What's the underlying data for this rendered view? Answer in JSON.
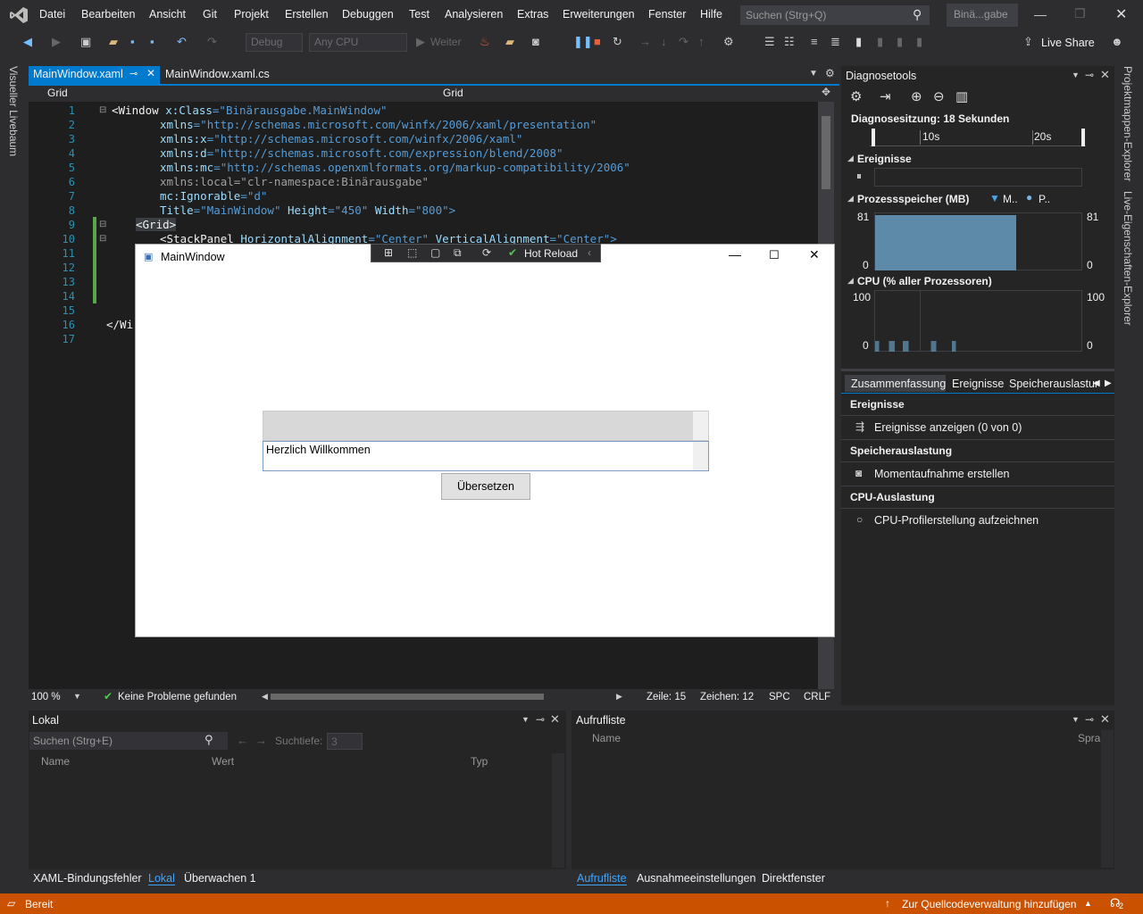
{
  "menu": [
    "Datei",
    "Bearbeiten",
    "Ansicht",
    "Git",
    "Projekt",
    "Erstellen",
    "Debuggen",
    "Test",
    "Analysieren",
    "Extras",
    "Erweiterungen",
    "Fenster",
    "Hilfe"
  ],
  "search_placeholder": "Suchen (Strg+Q)",
  "solution_name": "Binä...gabe",
  "toolbar": {
    "config": "Debug",
    "platform": "Any CPU",
    "continue": "Weiter",
    "live_share": "Live Share"
  },
  "tabs": {
    "active": "MainWindow.xaml",
    "other": "MainWindow.xaml.cs",
    "nav_left": "Grid",
    "nav_right": "Grid"
  },
  "side_left": "Visueller Livebaum",
  "side_right_1": "Projektmappen-Explorer",
  "side_right_2": "Live-Eigenschaften-Explorer",
  "line_numbers": [
    "1",
    "2",
    "3",
    "4",
    "5",
    "6",
    "7",
    "8",
    "9",
    "10",
    "11",
    "12",
    "13",
    "14",
    "15",
    "16",
    "17"
  ],
  "code": {
    "l1a": "<Window ",
    "l1b": "x:Class",
    "l1c": "=\"Binärausgabe.MainWindow\"",
    "l2a": "xmlns",
    "l2b": "=\"http://schemas.microsoft.com/winfx/2006/xaml/presentation\"",
    "l3a": "xmlns:x",
    "l3b": "=\"http://schemas.microsoft.com/winfx/2006/xaml\"",
    "l4a": "xmlns:d",
    "l4b": "=\"http://schemas.microsoft.com/expression/blend/2008\"",
    "l5a": "xmlns:mc",
    "l5b": "=\"http://schemas.openxmlformats.org/markup-compatibility/2006\"",
    "l6": "xmlns:local=\"clr-namespace:Binärausgabe\"",
    "l7a": "mc:Ignorable",
    "l7b": "=\"d\"",
    "l8a": "Title",
    "l8b": "=\"MainWindow\" ",
    "l8c": "Height",
    "l8d": "=\"450\" ",
    "l8e": "Width",
    "l8f": "=\"800\">",
    "l9": "<Grid>",
    "l10a": "<StackPanel ",
    "l10b": "HorizontalAlignment",
    "l10c": "=\"Center\" ",
    "l10d": "VerticalAlignment",
    "l10e": "=\"Center\">",
    "l16": "</Wi"
  },
  "editor_status": {
    "zoom": "100 %",
    "problems": "Keine Probleme gefunden",
    "line": "Zeile: 15",
    "char": "Zeichen: 12",
    "spc": "SPC",
    "crlf": "CRLF"
  },
  "wpf": {
    "title": "MainWindow",
    "hotreload": "Hot Reload",
    "textbox2": "Herzlich Willkommen",
    "button": "Übersetzen"
  },
  "diag": {
    "title": "Diagnosetools",
    "session": "Diagnosesitzung: 18 Sekunden",
    "t10": "10s",
    "t20": "20s",
    "events": "Ereignisse",
    "memory": "Prozessspeicher (MB)",
    "mem_legend_m": "M..",
    "mem_legend_p": "P..",
    "mem_max": "81",
    "mem_min": "0",
    "cpu": "CPU (% aller Prozessoren)",
    "cpu_max": "100",
    "cpu_min": "0",
    "tab_summary": "Zusammenfassung",
    "tab_events": "Ereignisse",
    "tab_memory": "Speicherauslastur",
    "sec_events": "Ereignisse",
    "show_events": "Ereignisse anzeigen (0 von 0)",
    "sec_memory": "Speicherauslastung",
    "snapshot": "Momentaufnahme erstellen",
    "sec_cpu": "CPU-Auslastung",
    "cpu_profile": "CPU-Profilerstellung aufzeichnen"
  },
  "lokal": {
    "title": "Lokal",
    "search": "Suchen (Strg+E)",
    "depth_label": "Suchtiefe:",
    "depth": "3",
    "col_name": "Name",
    "col_value": "Wert",
    "col_type": "Typ",
    "tab1": "XAML-Bindungsfehler",
    "tab2": "Lokal",
    "tab3": "Überwachen 1"
  },
  "callstack": {
    "title": "Aufrufliste",
    "col_name": "Name",
    "col_lang": "Spra",
    "tab1": "Aufrufliste",
    "tab2": "Ausnahmeeinstellungen",
    "tab3": "Direktfenster"
  },
  "status": {
    "ready": "Bereit",
    "source_control": "Zur Quellcodeverwaltung hinzufügen",
    "notif": "2"
  },
  "colors": {
    "accent": "#007acc",
    "status": "#ca5100",
    "bg": "#2d2d30",
    "editor": "#1e1e1e"
  }
}
